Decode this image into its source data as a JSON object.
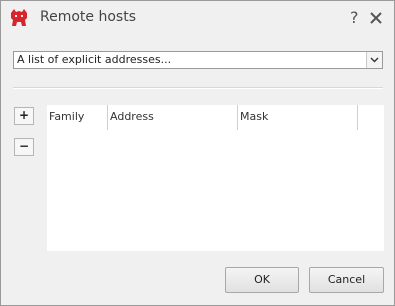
{
  "window": {
    "title": "Remote hosts",
    "help_label": "?",
    "icon": "bullguard-dog-icon",
    "close_icon": "close-icon"
  },
  "selector": {
    "value": "A list of explicit addresses..."
  },
  "side_buttons": {
    "add_label": "+",
    "remove_label": "−"
  },
  "table": {
    "columns": [
      "Family",
      "Address",
      "Mask"
    ],
    "rows": []
  },
  "buttons": {
    "ok_label": "OK",
    "cancel_label": "Cancel"
  },
  "colors": {
    "brand": "#d8242a",
    "background": "#f0f0f0"
  }
}
